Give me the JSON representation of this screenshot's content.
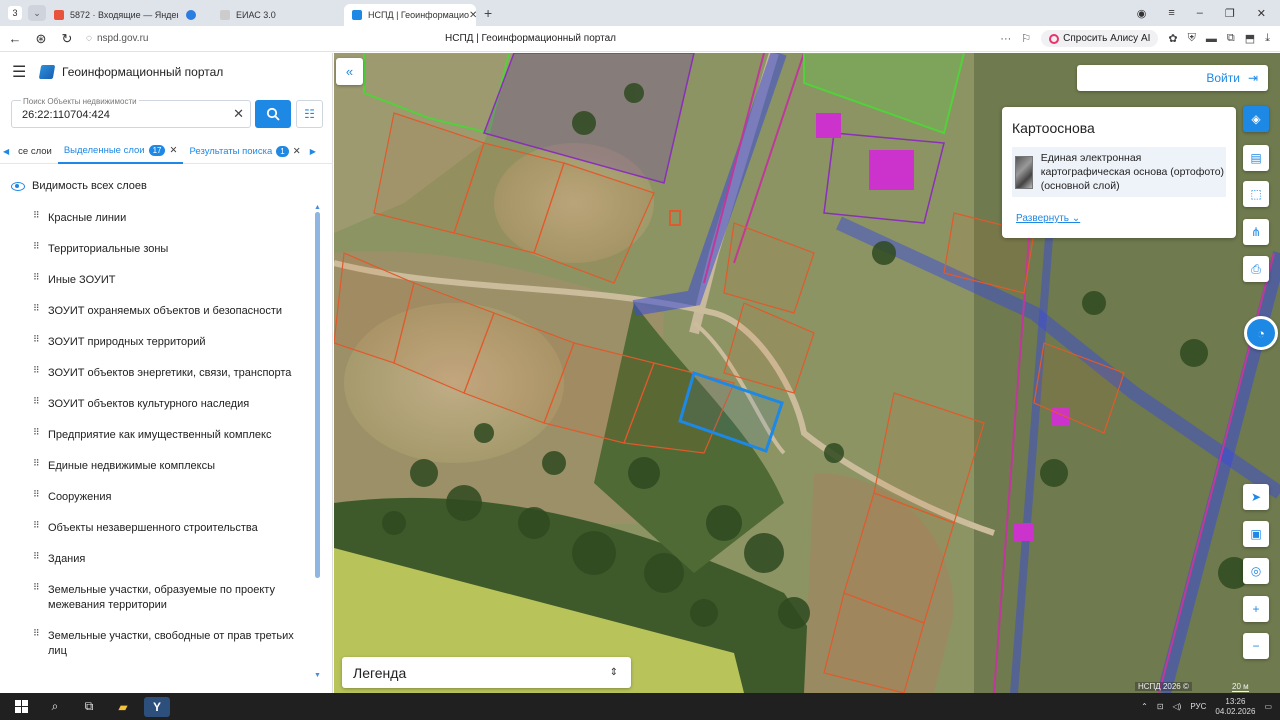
{
  "browser": {
    "tab_count": "3",
    "tabs": [
      {
        "label": "5872 · Входящие — Яндекс",
        "icon": "mail-icon",
        "color": "#e8533c"
      },
      {
        "label": "",
        "icon": "app-icon",
        "color": "#2a7de1"
      },
      {
        "label": "ЕИАС 3.0",
        "icon": "page-icon",
        "color": "#cccccc"
      },
      {
        "label": "НСПД | Геоинформацио",
        "icon": "nspd-icon",
        "color": "#1e88e5"
      }
    ],
    "url": "nspd.gov.ru",
    "page_title": "НСПД | Геоинформационный портал",
    "alice_label": "Спросить Алису AI"
  },
  "app": {
    "title": "Геоинформационный портал",
    "search": {
      "label": "Поиск Объекты недвижимости",
      "value": "26:22:110704:424"
    },
    "tabs": [
      {
        "label": "се слои"
      },
      {
        "label": "Выделенные слои",
        "badge": "17"
      },
      {
        "label": "Результаты поиска",
        "badge": "1"
      }
    ],
    "visibility_label": "Видимость всех слоев",
    "layers": [
      "Красные линии",
      "Территориальные зоны",
      "Иные ЗОУИТ",
      "ЗОУИТ охраняемых объектов и безопасности",
      "ЗОУИТ природных территорий",
      "ЗОУИТ объектов энергетики, связи, транспорта",
      "ЗОУИТ объектов культурного наследия",
      "Предприятие как имущественный комплекс",
      "Единые недвижимые комплексы",
      "Сооружения",
      "Объекты незавершенного строительства",
      "Здания",
      "Земельные участки, образуемые по проекту межевания территории",
      "Земельные участки, свободные от прав третьих лиц"
    ]
  },
  "map": {
    "login_label": "Войти",
    "basemap": {
      "title": "Картооснова",
      "item": "Единая электронная картографическая основа (ортофото)(основной слой)",
      "expand_label": "Развернуть"
    },
    "legend_label": "Легенда",
    "copyright": "НСПД 2026 ©",
    "scale": "20 м",
    "colors": {
      "accent": "#1e88e5",
      "parcel": "#e05a2b",
      "zone_blue": "#3b4bd8",
      "green_zone": "#52d13b",
      "purple": "#8a2fb8"
    }
  },
  "taskbar": {
    "language": "РУС",
    "time": "13:26",
    "date": "04.02.2026"
  }
}
